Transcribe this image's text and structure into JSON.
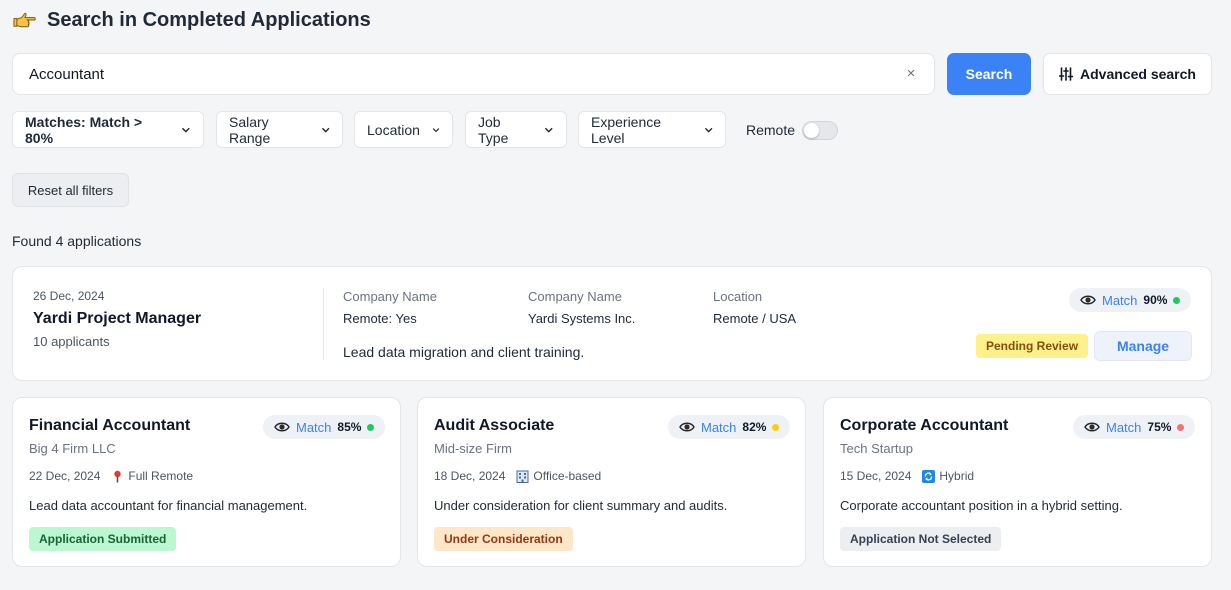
{
  "header": {
    "title": "Search in Completed Applications",
    "icon": "pointing-hand-icon"
  },
  "search": {
    "value": "Accountant",
    "clear_label": "×",
    "button_label": "Search",
    "advanced_label": "Advanced search"
  },
  "filters": {
    "matches": "Matches: Match > 80%",
    "salary": "Salary Range",
    "location": "Location",
    "job_type": "Job Type",
    "experience": "Experience Level",
    "remote_label": "Remote",
    "remote_on": false,
    "reset_label": "Reset all filters"
  },
  "results": {
    "found_text": "Found 4 applications"
  },
  "featured": {
    "date": "26 Dec, 2024",
    "title": "Yardi Project Manager",
    "applicants": "10 applicants",
    "col1_label": "Company Name",
    "col1_value": "Remote: Yes",
    "col2_label": "Company Name",
    "col2_value": "Yardi Systems Inc.",
    "col3_label": "Location",
    "col3_value": "Remote / USA",
    "description": "Lead data migration and client training.",
    "match_label": "Match",
    "match_value": "90%",
    "match_color": "#22c55e",
    "status": "Pending Review",
    "manage_label": "Manage"
  },
  "cards": [
    {
      "title": "Financial Accountant",
      "company": "Big 4 Firm LLC",
      "date": "22 Dec, 2024",
      "workplace": "Full Remote",
      "workplace_icon": "pin-icon",
      "description": "Lead data accountant for financial management.",
      "match_label": "Match",
      "match_value": "85%",
      "match_color": "#22c55e",
      "status": "Application Submitted"
    },
    {
      "title": "Audit Associate",
      "company": "Mid-size Firm",
      "date": "18 Dec, 2024",
      "workplace": "Office-based",
      "workplace_icon": "office-building-icon",
      "description": "Under consideration for client summary and audits.",
      "match_label": "Match",
      "match_value": "82%",
      "match_color": "#facc15",
      "status": "Under Consideration"
    },
    {
      "title": "Corporate Accountant",
      "company": "Tech Startup",
      "date": "15 Dec, 2024",
      "workplace": "Hybrid",
      "workplace_icon": "hybrid-arrows-icon",
      "description": "Corporate accountant position in a hybrid setting.",
      "match_label": "Match",
      "match_value": "75%",
      "match_color": "#f87171",
      "status": "Application Not Selected"
    }
  ]
}
